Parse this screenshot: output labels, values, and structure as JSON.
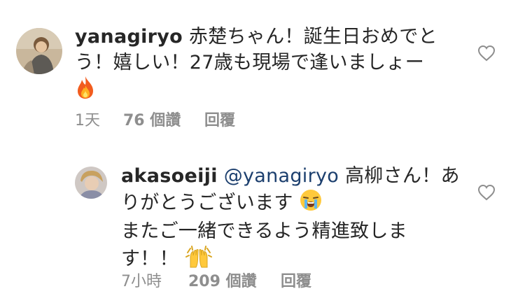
{
  "comments": [
    {
      "username": "yanagiryo",
      "lines": [
        "赤楚ちゃん！誕生日おめでと",
        "う！嬉しい！27歳も現場で逢いましょー"
      ],
      "emoji_line": "fire-emoji",
      "time": "1天",
      "likes": "76 個讚",
      "reply": "回覆"
    },
    {
      "username": "akasoeiji",
      "mention": "@yanagiryo",
      "lines": [
        "高柳さん！あ",
        "りがとうございます",
        "またご一緒できるよう精進致しま",
        "す！！"
      ],
      "time": "7小時",
      "likes": "209 個讚",
      "reply": "回覆"
    }
  ],
  "icons": {
    "like": "heart-outline-icon",
    "fire": "fire-emoji",
    "crying": "loudly-crying-face-emoji",
    "raised_hands": "raising-hands-emoji"
  }
}
